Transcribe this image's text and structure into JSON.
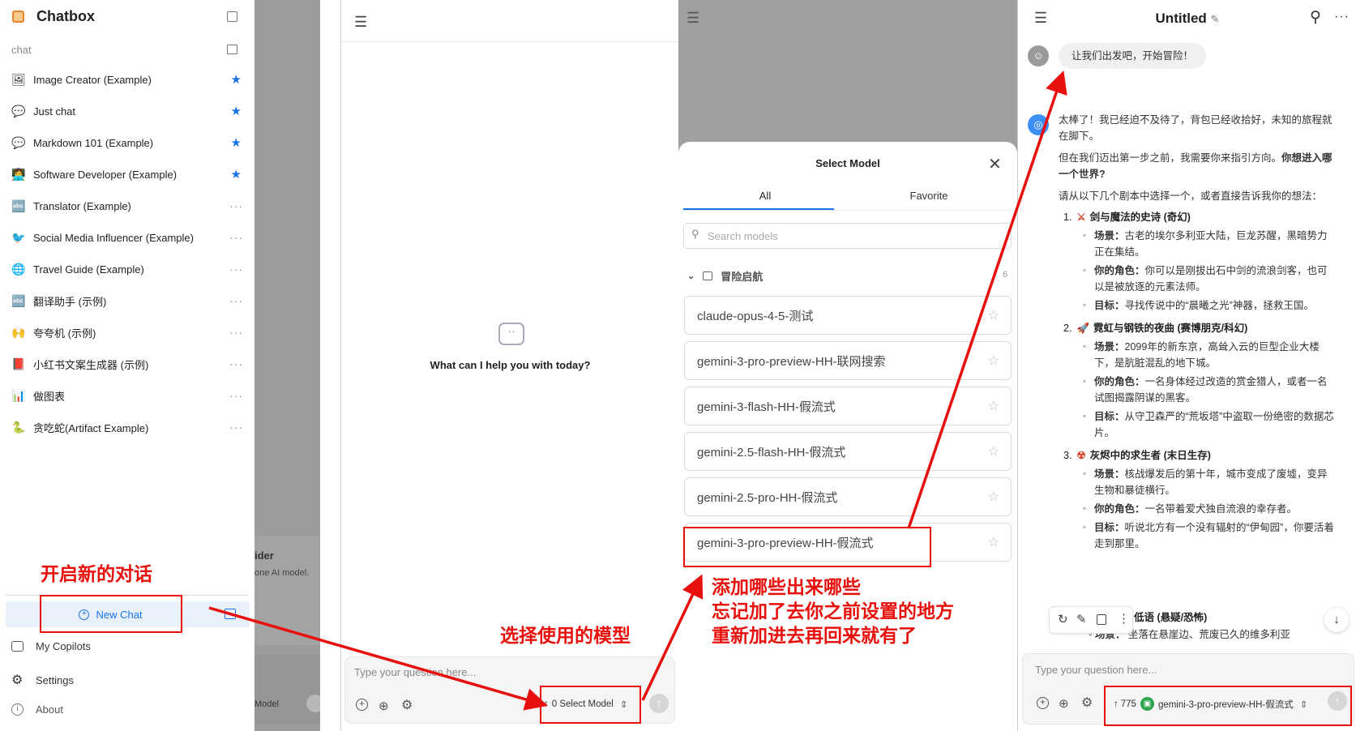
{
  "sidebar": {
    "app_title": "Chatbox",
    "section": "chat",
    "items": [
      {
        "label": "Image Creator (Example)",
        "icon": "image-icon",
        "action": "star"
      },
      {
        "label": "Just chat",
        "icon": "chat-bubble-icon",
        "action": "star"
      },
      {
        "label": "Markdown 101 (Example)",
        "icon": "chat-bubble-icon",
        "action": "star"
      },
      {
        "label": "Software Developer (Example)",
        "icon": "developer-avatar-icon",
        "action": "star"
      },
      {
        "label": "Translator (Example)",
        "icon": "translator-avatar-icon",
        "action": "dots"
      },
      {
        "label": "Social Media Influencer (Example)",
        "icon": "twitter-bird-icon",
        "action": "dots"
      },
      {
        "label": "Travel Guide (Example)",
        "icon": "globe-avatar-icon",
        "action": "dots"
      },
      {
        "label": "翻译助手 (示例)",
        "icon": "translator-avatar-icon",
        "action": "dots"
      },
      {
        "label": "夸夸机 (示例)",
        "icon": "cheer-avatar-icon",
        "action": "dots"
      },
      {
        "label": "小红书文案生成器 (示例)",
        "icon": "xiaohongshu-avatar-icon",
        "action": "dots"
      },
      {
        "label": "做图表",
        "icon": "chart-avatar-icon",
        "action": "dots"
      },
      {
        "label": "贪吃蛇(Artifact Example)",
        "icon": "snake-game-avatar-icon",
        "action": "dots"
      }
    ],
    "new_chat": "New Chat",
    "bottom": [
      "My Copilots",
      "Settings",
      "About"
    ],
    "behind_fragments": {
      "a": "ider",
      "b": "one AI model.",
      "c": "Model"
    }
  },
  "empty_chat": {
    "prompt": "What can I help you with today?",
    "input_placeholder": "Type your question here...",
    "model_selector": "0 Select Model"
  },
  "model_picker": {
    "title": "Select Model",
    "tabs": [
      "All",
      "Favorite"
    ],
    "search_placeholder": "Search models",
    "group": "冒险启航",
    "group_count": "6",
    "models": [
      "claude-opus-4-5-测试",
      "gemini-3-pro-preview-HH-联网搜索",
      "gemini-3-flash-HH-假流式",
      "gemini-2.5-flash-HH-假流式",
      "gemini-2.5-pro-HH-假流式",
      "gemini-3-pro-preview-HH-假流式"
    ]
  },
  "conversation": {
    "title": "Untitled",
    "user_message": "让我们出发吧，开始冒险！",
    "ai_intro_1": "太棒了！我已经迫不及待了，背包已经收拾好，未知的旅程就在脚下。",
    "ai_intro_2a": "但在我们迈出第一步之前，我需要你来指引方向。",
    "ai_intro_2b": "你想进入哪一个世界?",
    "ai_intro_3": "请从以下几个剧本中选择一个，或者直接告诉我你的想法：",
    "scenarios": [
      {
        "num": "1.",
        "emoji": "⚔",
        "title": "剑与魔法的史诗 (奇幻)",
        "items": [
          {
            "k": "场景：",
            "v": "古老的埃尔多利亚大陆，巨龙苏醒，黑暗势力正在集结。"
          },
          {
            "k": "你的角色：",
            "v": "你可以是刚拔出石中剑的流浪剑客，也可以是被放逐的元素法师。"
          },
          {
            "k": "目标：",
            "v": "寻找传说中的“晨曦之光”神器，拯救王国。"
          }
        ]
      },
      {
        "num": "2.",
        "emoji": "🚀",
        "title": "霓虹与钢铁的夜曲 (赛博朋克/科幻)",
        "items": [
          {
            "k": "场景：",
            "v": "2099年的新东京，高耸入云的巨型企业大楼下，是肮脏混乱的地下城。"
          },
          {
            "k": "你的角色：",
            "v": "一名身体经过改造的赏金猎人，或者一名试图揭露阴谋的黑客。"
          },
          {
            "k": "目标：",
            "v": "从守卫森严的“荒坂塔”中盗取一份绝密的数据芯片。"
          }
        ]
      },
      {
        "num": "3.",
        "emoji": "☢",
        "title": "灰烬中的求生者 (末日生存)",
        "items": [
          {
            "k": "场景：",
            "v": "核战爆发后的第十年，城市变成了废墟，变异生物和暴徒横行。"
          },
          {
            "k": "你的角色：",
            "v": "一名带着爱犬独自流浪的幸存者。"
          },
          {
            "k": "目标：",
            "v": "听说北方有一个没有辐射的“伊甸园”，你要活着走到那里。"
          }
        ]
      }
    ],
    "partial_4_title": "低语 (悬疑/恐怖)",
    "partial_4_item": "坐落在悬崖边、荒废已久的维多利亚",
    "partial_4_key": "场景：",
    "input_placeholder": "Type your question here...",
    "token_count": "775",
    "selected_model": "gemini-3-pro-preview-HH-假流式"
  },
  "annotations": {
    "new_chat": "开启新的对话",
    "select_model": "选择使用的模型",
    "add_models_1": "添加哪些出来哪些",
    "add_models_2": "忘记加了去你之前设置的地方",
    "add_models_3": "重新加进去再回来就有了"
  }
}
